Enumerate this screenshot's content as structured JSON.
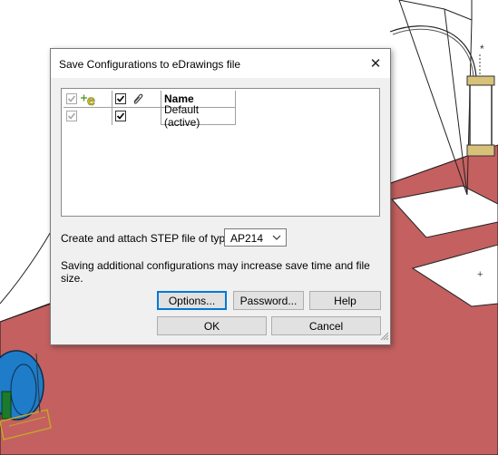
{
  "dialog": {
    "title": "Save Configurations to eDrawings file",
    "close_symbol": "✕"
  },
  "config_list": {
    "header": {
      "name": "Name",
      "col1_icon": "edrawings-icon",
      "col2_icon": "paperclip-icon"
    },
    "rows": [
      {
        "name": "Default (active)",
        "edrawings_checked": true,
        "attach_checked": true
      }
    ]
  },
  "step": {
    "label": "Create and attach STEP file of type:",
    "value": "AP214"
  },
  "note": "Saving additional configurations may increase save time and file size.",
  "buttons": {
    "options": "Options...",
    "password": "Password...",
    "help": "Help",
    "ok": "OK",
    "cancel": "Cancel"
  },
  "colors": {
    "floor": "#c46060",
    "dialog_bg": "#f0f0f0",
    "accent": "#0078d7"
  }
}
